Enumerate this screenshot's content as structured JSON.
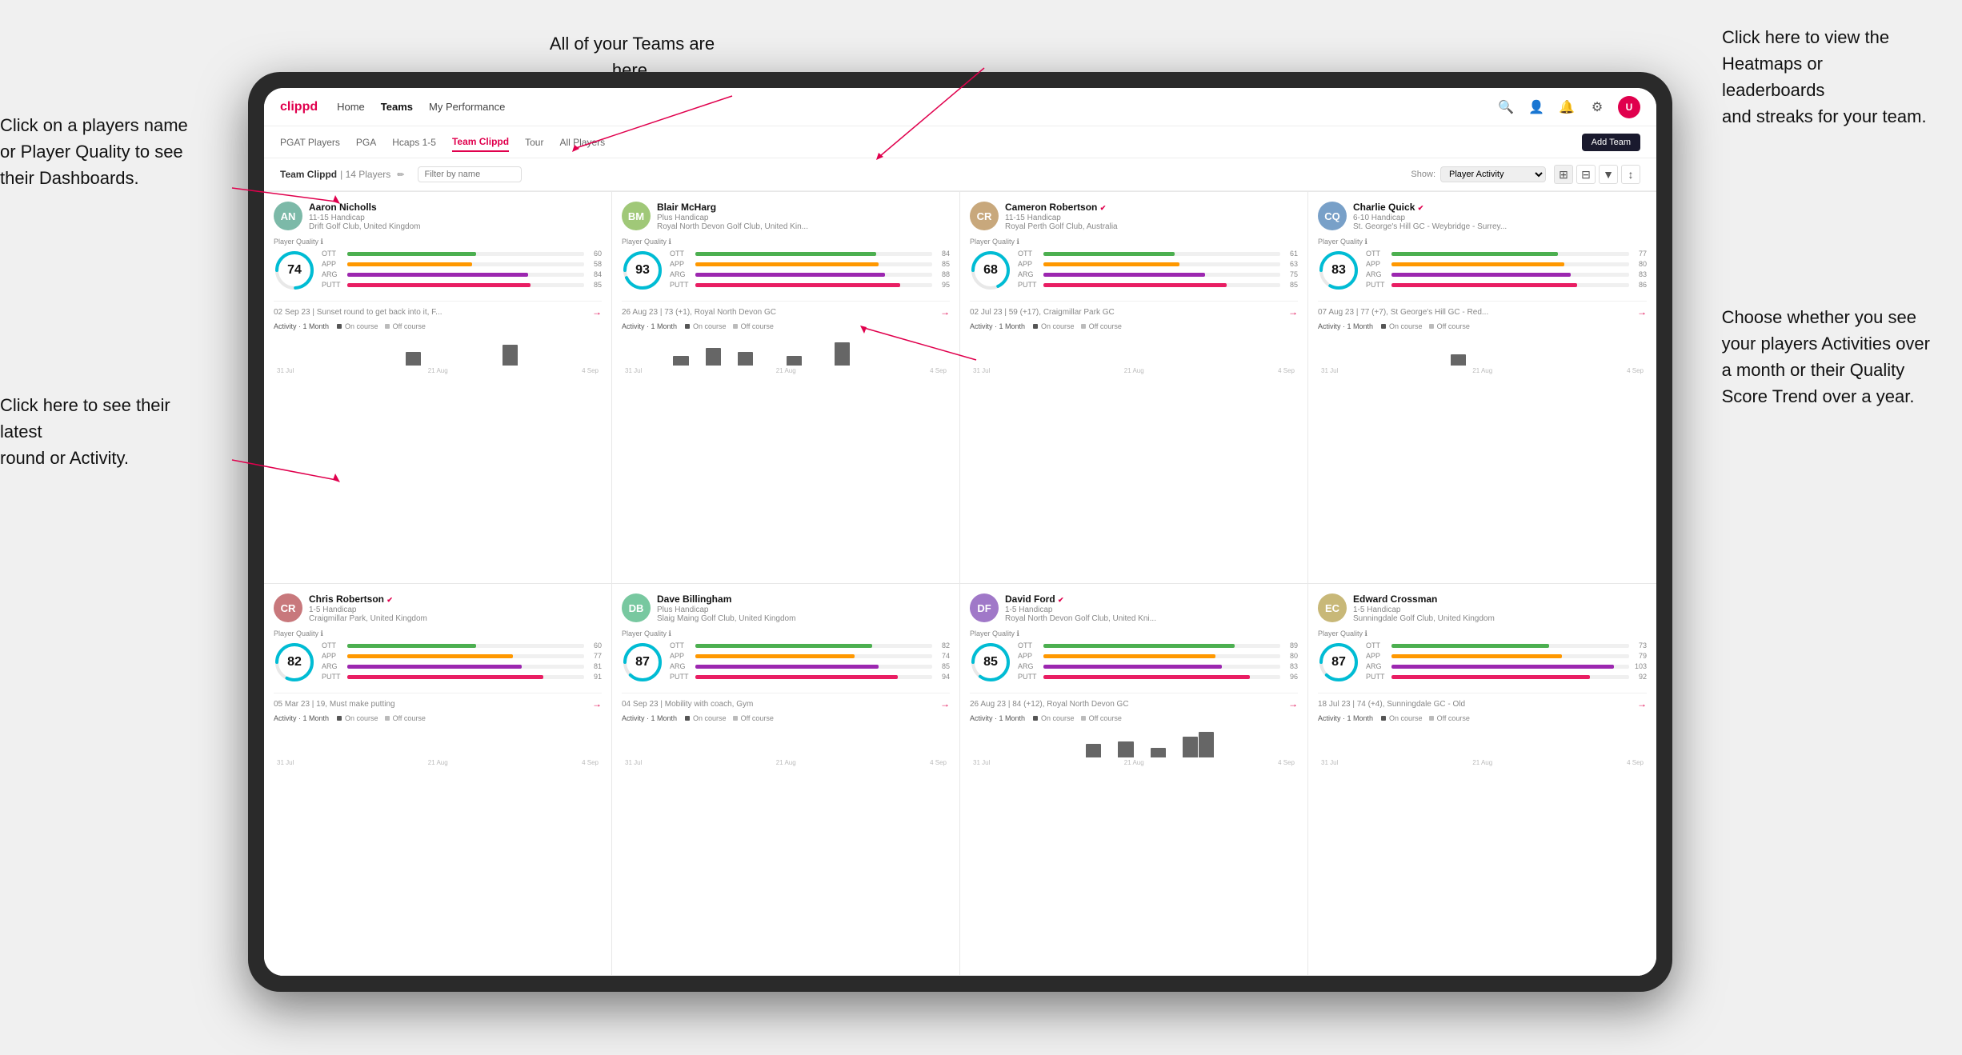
{
  "annotations": {
    "top_center": "All of your Teams are here.",
    "top_right": "Click here to view the\nHeatmaps or leaderboards\nand streaks for your team.",
    "left_top": "Click on a players name\nor Player Quality to see\ntheir Dashboards.",
    "left_bottom": "Click here to see their latest\nround or Activity.",
    "right_bottom": "Choose whether you see\nyour players Activities over\na month or their Quality\nScore Trend over a year."
  },
  "nav": {
    "logo": "clippd",
    "links": [
      "Home",
      "Teams",
      "My Performance"
    ],
    "active": "Teams"
  },
  "subtabs": {
    "items": [
      "PGAT Players",
      "PGA",
      "Hcaps 1-5",
      "Team Clippd",
      "Tour",
      "All Players"
    ],
    "active": "Team Clippd",
    "add_team": "Add Team"
  },
  "team_header": {
    "title": "Team Clippd",
    "separator": "|",
    "count": "14 Players",
    "filter_placeholder": "Filter by name",
    "show_label": "Show:",
    "show_value": "Player Activity",
    "view_options": [
      "grid",
      "table",
      "filter",
      "settings"
    ]
  },
  "players": [
    {
      "id": "p1",
      "name": "Aaron Nicholls",
      "handicap": "11-15 Handicap",
      "club": "Drift Golf Club, United Kingdom",
      "verified": false,
      "quality": 74,
      "quality_color": "#00bcd4",
      "stats": [
        {
          "label": "OTT",
          "value": 60,
          "color": "#4caf50"
        },
        {
          "label": "APP",
          "value": 58,
          "color": "#ff9800"
        },
        {
          "label": "ARG",
          "value": 84,
          "color": "#9c27b0"
        },
        {
          "label": "PUTT",
          "value": 85,
          "color": "#e91e63"
        }
      ],
      "latest_round": "02 Sep 23 | Sunset round to get back into it, F...",
      "activity_dates": [
        "31 Jul",
        "21 Aug",
        "4 Sep"
      ],
      "bars": [
        0,
        0,
        0,
        0,
        0,
        0,
        0,
        0,
        12,
        0,
        0,
        0,
        0,
        0,
        18,
        0,
        0,
        0,
        0,
        0
      ],
      "avatar_color": "#7cb9a8",
      "avatar_initials": "AN"
    },
    {
      "id": "p2",
      "name": "Blair McHarg",
      "handicap": "Plus Handicap",
      "club": "Royal North Devon Golf Club, United Kin...",
      "verified": false,
      "quality": 93,
      "quality_color": "#00bcd4",
      "stats": [
        {
          "label": "OTT",
          "value": 84,
          "color": "#4caf50"
        },
        {
          "label": "APP",
          "value": 85,
          "color": "#ff9800"
        },
        {
          "label": "ARG",
          "value": 88,
          "color": "#9c27b0"
        },
        {
          "label": "PUTT",
          "value": 95,
          "color": "#e91e63"
        }
      ],
      "latest_round": "26 Aug 23 | 73 (+1), Royal North Devon GC",
      "activity_dates": [
        "31 Jul",
        "21 Aug",
        "4 Sep"
      ],
      "bars": [
        0,
        0,
        0,
        8,
        0,
        15,
        0,
        12,
        0,
        0,
        8,
        0,
        0,
        20,
        0,
        0,
        0,
        0,
        0,
        0
      ],
      "avatar_color": "#a0c878",
      "avatar_initials": "BM"
    },
    {
      "id": "p3",
      "name": "Cameron Robertson",
      "handicap": "11-15 Handicap",
      "club": "Royal Perth Golf Club, Australia",
      "verified": true,
      "quality": 68,
      "quality_color": "#00bcd4",
      "stats": [
        {
          "label": "OTT",
          "value": 61,
          "color": "#4caf50"
        },
        {
          "label": "APP",
          "value": 63,
          "color": "#ff9800"
        },
        {
          "label": "ARG",
          "value": 75,
          "color": "#9c27b0"
        },
        {
          "label": "PUTT",
          "value": 85,
          "color": "#e91e63"
        }
      ],
      "latest_round": "02 Jul 23 | 59 (+17), Craigmillar Park GC",
      "activity_dates": [
        "31 Jul",
        "21 Aug",
        "4 Sep"
      ],
      "bars": [
        0,
        0,
        0,
        0,
        0,
        0,
        0,
        0,
        0,
        0,
        0,
        0,
        0,
        0,
        0,
        0,
        0,
        0,
        0,
        0
      ],
      "avatar_color": "#c8a87c",
      "avatar_initials": "CR"
    },
    {
      "id": "p4",
      "name": "Charlie Quick",
      "handicap": "6-10 Handicap",
      "club": "St. George's Hill GC - Weybridge - Surrey...",
      "verified": true,
      "quality": 83,
      "quality_color": "#00bcd4",
      "stats": [
        {
          "label": "OTT",
          "value": 77,
          "color": "#4caf50"
        },
        {
          "label": "APP",
          "value": 80,
          "color": "#ff9800"
        },
        {
          "label": "ARG",
          "value": 83,
          "color": "#9c27b0"
        },
        {
          "label": "PUTT",
          "value": 86,
          "color": "#e91e63"
        }
      ],
      "latest_round": "07 Aug 23 | 77 (+7), St George's Hill GC - Red...",
      "activity_dates": [
        "31 Jul",
        "21 Aug",
        "4 Sep"
      ],
      "bars": [
        0,
        0,
        0,
        0,
        0,
        0,
        0,
        0,
        10,
        0,
        0,
        0,
        0,
        0,
        0,
        0,
        0,
        0,
        0,
        0
      ],
      "avatar_color": "#78a0c8",
      "avatar_initials": "CQ"
    },
    {
      "id": "p5",
      "name": "Chris Robertson",
      "handicap": "1-5 Handicap",
      "club": "Craigmillar Park, United Kingdom",
      "verified": true,
      "quality": 82,
      "quality_color": "#00bcd4",
      "stats": [
        {
          "label": "OTT",
          "value": 60,
          "color": "#4caf50"
        },
        {
          "label": "APP",
          "value": 77,
          "color": "#ff9800"
        },
        {
          "label": "ARG",
          "value": 81,
          "color": "#9c27b0"
        },
        {
          "label": "PUTT",
          "value": 91,
          "color": "#e91e63"
        }
      ],
      "latest_round": "05 Mar 23 | 19, Must make putting",
      "activity_dates": [
        "31 Jul",
        "21 Aug",
        "4 Sep"
      ],
      "bars": [
        0,
        0,
        0,
        0,
        0,
        0,
        0,
        0,
        0,
        0,
        0,
        0,
        0,
        0,
        0,
        0,
        0,
        0,
        0,
        0
      ],
      "avatar_color": "#c8787c",
      "avatar_initials": "CR"
    },
    {
      "id": "p6",
      "name": "Dave Billingham",
      "handicap": "Plus Handicap",
      "club": "Slaig Maing Golf Club, United Kingdom",
      "verified": false,
      "quality": 87,
      "quality_color": "#00bcd4",
      "stats": [
        {
          "label": "OTT",
          "value": 82,
          "color": "#4caf50"
        },
        {
          "label": "APP",
          "value": 74,
          "color": "#ff9800"
        },
        {
          "label": "ARG",
          "value": 85,
          "color": "#9c27b0"
        },
        {
          "label": "PUTT",
          "value": 94,
          "color": "#e91e63"
        }
      ],
      "latest_round": "04 Sep 23 | Mobility with coach, Gym",
      "activity_dates": [
        "31 Jul",
        "21 Aug",
        "4 Sep"
      ],
      "bars": [
        0,
        0,
        0,
        0,
        0,
        0,
        0,
        0,
        0,
        0,
        0,
        0,
        0,
        0,
        0,
        0,
        0,
        0,
        0,
        0
      ],
      "avatar_color": "#78c8a0",
      "avatar_initials": "DB"
    },
    {
      "id": "p7",
      "name": "David Ford",
      "handicap": "1-5 Handicap",
      "club": "Royal North Devon Golf Club, United Kni...",
      "verified": true,
      "quality": 85,
      "quality_color": "#00bcd4",
      "stats": [
        {
          "label": "OTT",
          "value": 89,
          "color": "#4caf50"
        },
        {
          "label": "APP",
          "value": 80,
          "color": "#ff9800"
        },
        {
          "label": "ARG",
          "value": 83,
          "color": "#9c27b0"
        },
        {
          "label": "PUTT",
          "value": 96,
          "color": "#e91e63"
        }
      ],
      "latest_round": "26 Aug 23 | 84 (+12), Royal North Devon GC",
      "activity_dates": [
        "31 Jul",
        "21 Aug",
        "4 Sep"
      ],
      "bars": [
        0,
        0,
        0,
        0,
        0,
        0,
        0,
        12,
        0,
        14,
        0,
        8,
        0,
        18,
        22,
        0,
        0,
        0,
        0,
        0
      ],
      "avatar_color": "#a078c8",
      "avatar_initials": "DF"
    },
    {
      "id": "p8",
      "name": "Edward Crossman",
      "handicap": "1-5 Handicap",
      "club": "Sunningdale Golf Club, United Kingdom",
      "verified": false,
      "quality": 87,
      "quality_color": "#00bcd4",
      "stats": [
        {
          "label": "OTT",
          "value": 73,
          "color": "#4caf50"
        },
        {
          "label": "APP",
          "value": 79,
          "color": "#ff9800"
        },
        {
          "label": "ARG",
          "value": 103,
          "color": "#9c27b0"
        },
        {
          "label": "PUTT",
          "value": 92,
          "color": "#e91e63"
        }
      ],
      "latest_round": "18 Jul 23 | 74 (+4), Sunningdale GC - Old",
      "activity_dates": [
        "31 Jul",
        "21 Aug",
        "4 Sep"
      ],
      "bars": [
        0,
        0,
        0,
        0,
        0,
        0,
        0,
        0,
        0,
        0,
        0,
        0,
        0,
        0,
        0,
        0,
        0,
        0,
        0,
        0
      ],
      "avatar_color": "#c8b878",
      "avatar_initials": "EC"
    }
  ],
  "activity": {
    "label": "Activity",
    "period": "· 1 Month",
    "on_course_label": "On course",
    "off_course_label": "Off course",
    "on_course_color": "#555",
    "off_course_color": "#aaa"
  }
}
